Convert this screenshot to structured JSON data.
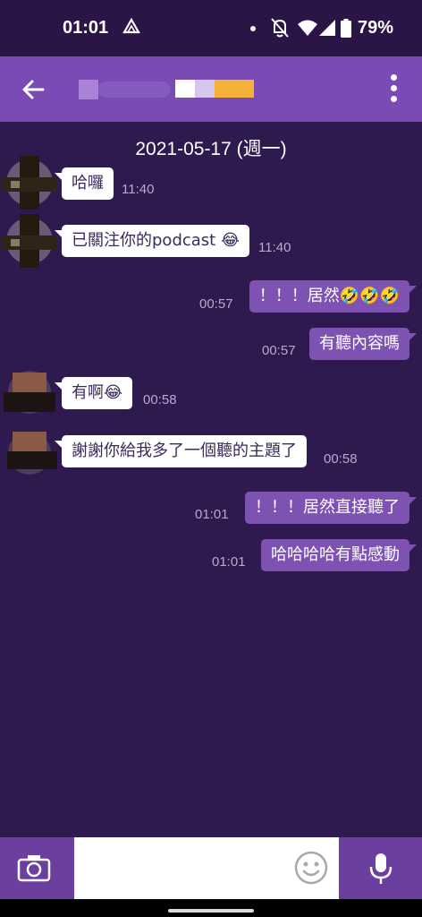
{
  "status_bar": {
    "time": "01:01",
    "battery_percent": "79%",
    "icons": [
      "drive-icon",
      "notification-dot-icon",
      "bell-off-icon",
      "wifi-icon",
      "signal-icon",
      "battery-icon"
    ]
  },
  "app_bar": {
    "icons": [
      "back-arrow-icon",
      "more-vert-icon"
    ]
  },
  "chat": {
    "date_header": "2021-05-17 (週一)",
    "messages": [
      {
        "side": "in",
        "text": "哈囉",
        "time": "11:40"
      },
      {
        "side": "in",
        "text": "已關注你的podcast 😂",
        "time": "11:40"
      },
      {
        "side": "out",
        "text": "！！！居然🤣🤣🤣",
        "time": "00:57"
      },
      {
        "side": "out",
        "text": "有聽內容嗎",
        "time": "00:57"
      },
      {
        "side": "in",
        "text": "有啊😂",
        "time": "00:58"
      },
      {
        "side": "in",
        "text": "謝謝你給我多了一個聽的主題了",
        "time": "00:58"
      },
      {
        "side": "out",
        "text": "！！！居然直接聽了",
        "time": "01:01"
      },
      {
        "side": "out",
        "text": "哈哈哈哈有點感動",
        "time": "01:01"
      }
    ]
  },
  "composer": {
    "placeholder": "",
    "icons": [
      "camera-icon",
      "emoji-icon",
      "microphone-icon"
    ]
  },
  "colors": {
    "background": "#2e1a4e",
    "app_bar": "#7a4ab5",
    "outgoing_bubble": "#7d52b3",
    "incoming_bubble": "#ffffff",
    "bottom_bar": "#6b3fa0"
  }
}
